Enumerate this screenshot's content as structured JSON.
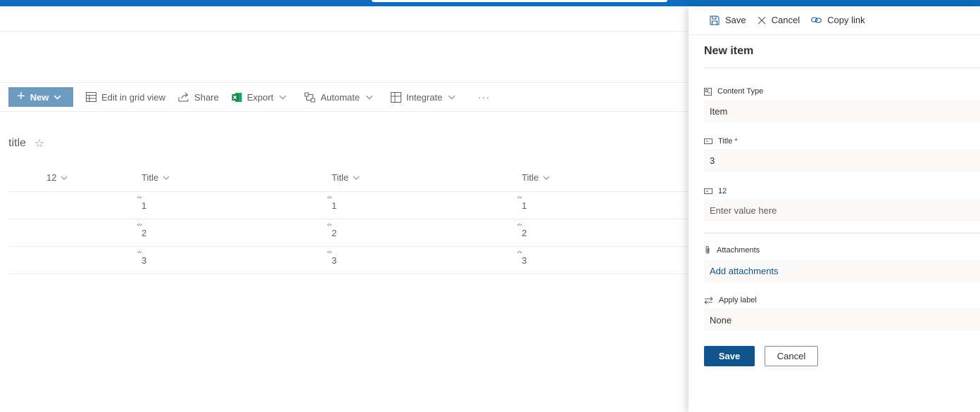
{
  "commandbar": {
    "new_label": "New",
    "edit_grid_label": "Edit in grid view",
    "share_label": "Share",
    "export_label": "Export",
    "automate_label": "Automate",
    "integrate_label": "Integrate",
    "more_label": "···"
  },
  "list": {
    "title": "title",
    "columns": [
      "12",
      "Title",
      "Title",
      "Title"
    ],
    "rows": [
      [
        "",
        "1",
        "1",
        "1"
      ],
      [
        "",
        "2",
        "2",
        "2"
      ],
      [
        "",
        "3",
        "3",
        "3"
      ]
    ]
  },
  "panel": {
    "save_label": "Save",
    "cancel_label": "Cancel",
    "copy_link_label": "Copy link",
    "title": "New item",
    "fields": {
      "content_type_label": "Content Type",
      "content_type_value": "Item",
      "title_label": "Title",
      "title_required": "*",
      "title_value": "3",
      "num_label": "12",
      "num_placeholder": "Enter value here",
      "attachments_label": "Attachments",
      "attachments_action": "Add attachments",
      "apply_label_label": "Apply label",
      "apply_label_value": "None"
    },
    "footer_save": "Save",
    "footer_cancel": "Cancel"
  },
  "colors": {
    "suite_bar": "#0f6cbd",
    "new_button": "#6c9ac0",
    "primary_button": "#0f548c"
  }
}
